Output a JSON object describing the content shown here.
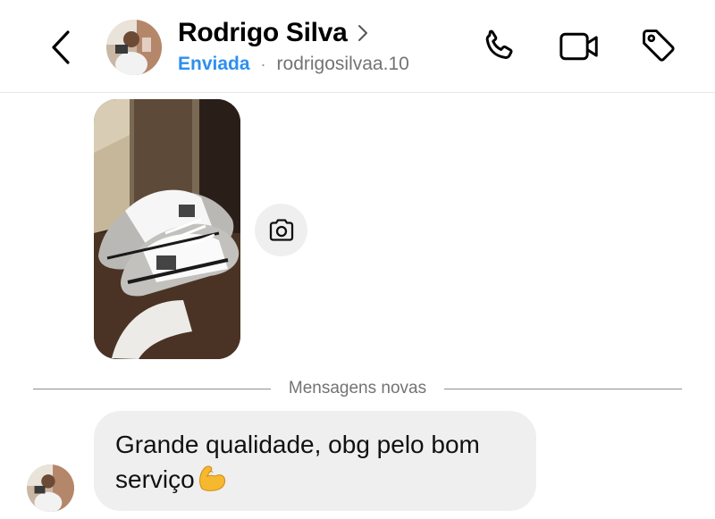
{
  "header": {
    "contact_name": "Rodrigo Silva",
    "status": "Enviada",
    "separator": "·",
    "username": "rodrigosilvaa.10",
    "icons": [
      "back-arrow-icon",
      "chevron-right-icon",
      "phone-icon",
      "video-camera-icon",
      "tag-icon"
    ]
  },
  "thread": {
    "attachment": {
      "type": "photo",
      "description_icon": "sneakers-photo"
    },
    "divider_label": "Mensagens novas",
    "message": {
      "text_line1": "Grande qualidade, obg pelo bom",
      "text_line2": "serviço",
      "emoji": "💪"
    }
  },
  "colors": {
    "status_blue": "#2b8ff0",
    "muted_gray": "#737373",
    "bubble_bg": "#efefef"
  }
}
